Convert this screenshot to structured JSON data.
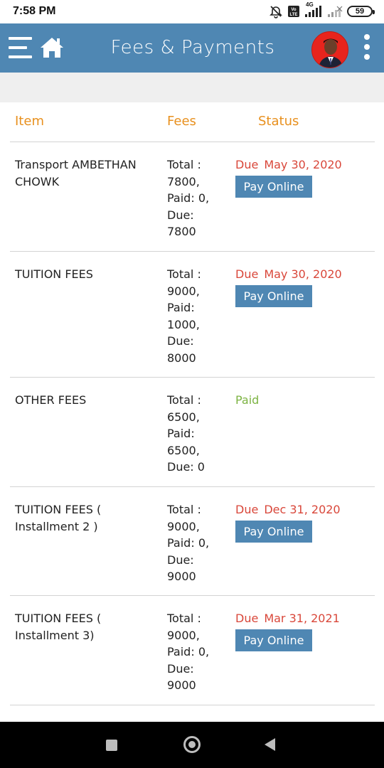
{
  "status_bar": {
    "time": "7:58 PM",
    "icons": [
      "alarm-off-icon",
      "volte-icon",
      "signal-4g-icon",
      "signal-icon"
    ],
    "network_label": "4G",
    "battery": "59"
  },
  "app_bar": {
    "title": "Fees & Payments",
    "menu_icon": "menu-icon",
    "home_icon": "home-icon",
    "overflow_icon": "more-vert-icon",
    "accent": "#4f87b3"
  },
  "table": {
    "headers": {
      "item": "Item",
      "fees": "Fees",
      "status": "Status"
    },
    "header_color": "#e8901e",
    "due_color": "#d9473a",
    "paid_color": "#7cb342",
    "rows": [
      {
        "item": "Transport AMBETHAN CHOWK",
        "fees": [
          "Total :",
          "7800,",
          "Paid: 0,",
          "Due:",
          "7800"
        ],
        "status": {
          "label": "Due",
          "date": "May 30, 2020",
          "button": "Pay Online"
        }
      },
      {
        "item": "TUITION FEES",
        "fees": [
          "Total :",
          "9000,",
          "Paid:",
          "1000,",
          "Due:",
          "8000"
        ],
        "status": {
          "label": "Due",
          "date": "May 30, 2020",
          "button": "Pay Online"
        }
      },
      {
        "item": "OTHER FEES",
        "fees": [
          "Total :",
          "6500,",
          "Paid:",
          "6500,",
          "Due: 0"
        ],
        "status": {
          "label": "Paid"
        }
      },
      {
        "item": "TUITION FEES ( Installment 2 )",
        "fees": [
          "Total :",
          "9000,",
          "Paid: 0,",
          "Due:",
          "9000"
        ],
        "status": {
          "label": "Due",
          "date": "Dec 31, 2020",
          "button": "Pay Online"
        }
      },
      {
        "item": "TUITION FEES ( Installment 3)",
        "fees": [
          "Total :",
          "9000,",
          "Paid: 0,",
          "Due:",
          "9000"
        ],
        "status": {
          "label": "Due",
          "date": "Mar 31, 2021",
          "button": "Pay Online"
        }
      }
    ]
  },
  "nav_bar": {
    "icons": [
      "recents-icon",
      "home-circle-icon",
      "back-icon"
    ]
  }
}
